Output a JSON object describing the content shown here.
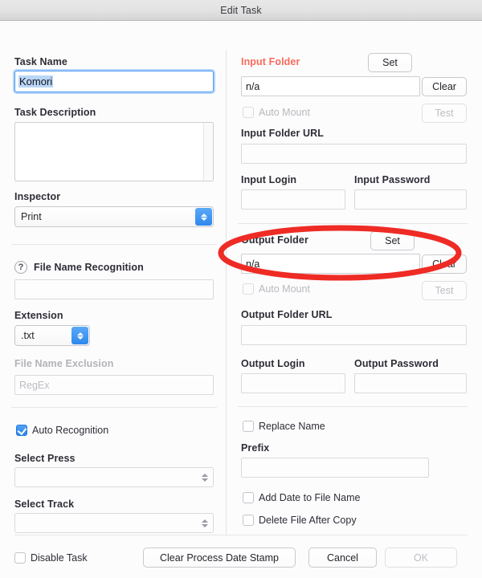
{
  "window": {
    "title": "Edit Task"
  },
  "colors": {
    "accent": "#2b84ea",
    "required_label": "#fb6a5c",
    "annotation": "#ee2b24",
    "titlebar": "#e2e2e2"
  },
  "left": {
    "task_name": {
      "label": "Task Name",
      "value": "Komori",
      "selected": true
    },
    "task_description": {
      "label": "Task Description",
      "value": "",
      "has_scrollbar": true
    },
    "inspector": {
      "label": "Inspector",
      "value": "Print",
      "options": [
        "Print"
      ]
    },
    "file_name_recognition": {
      "label": "File Name Recognition",
      "help_icon": "question-mark-icon",
      "value": ""
    },
    "extension": {
      "label": "Extension",
      "value": ".txt",
      "options": [
        ".txt"
      ]
    },
    "file_name_exclusion": {
      "label": "File Name Exclusion",
      "placeholder": "RegEx",
      "value": "",
      "disabled": true
    },
    "auto_recognition": {
      "label": "Auto Recognition",
      "checked": true
    },
    "select_press": {
      "label": "Select Press",
      "value": "",
      "options": []
    },
    "select_track": {
      "label": "Select Track",
      "value": "",
      "options": []
    }
  },
  "right": {
    "input_folder": {
      "label": "Input Folder",
      "required": true,
      "set_label": "Set",
      "clear_label": "Clear",
      "value": "n/a"
    },
    "input_auto_mount": {
      "label": "Auto Mount",
      "checked": false,
      "disabled": true,
      "test_label": "Test",
      "test_disabled": true
    },
    "input_folder_url": {
      "label": "Input Folder URL",
      "value": ""
    },
    "input_login": {
      "label": "Input Login",
      "value": ""
    },
    "input_password": {
      "label": "Input Password",
      "value": ""
    },
    "output_folder": {
      "label": "Output Folder",
      "set_label": "Set",
      "clear_label": "Clear",
      "value": "n/a"
    },
    "output_auto_mount": {
      "label": "Auto Mount",
      "checked": false,
      "disabled": true,
      "test_label": "Test",
      "test_disabled": true
    },
    "output_folder_url": {
      "label": "Output Folder URL",
      "value": ""
    },
    "output_login": {
      "label": "Output Login",
      "value": ""
    },
    "output_password": {
      "label": "Output Password",
      "value": ""
    },
    "replace_name": {
      "label": "Replace Name",
      "checked": false
    },
    "prefix": {
      "label": "Prefix",
      "value": ""
    },
    "add_date_to_file_name": {
      "label": "Add Date to File Name",
      "checked": false
    },
    "delete_file_after_copy": {
      "label": "Delete File After Copy",
      "checked": false
    }
  },
  "footer": {
    "disable_task": {
      "label": "Disable Task",
      "checked": false
    },
    "clear_process_date_stamp": "Clear Process Date Stamp",
    "cancel": "Cancel",
    "ok": "OK",
    "ok_disabled": true
  },
  "annotation": {
    "shape": "ellipse",
    "target": "Output Folder",
    "color": "#ee2b24"
  }
}
